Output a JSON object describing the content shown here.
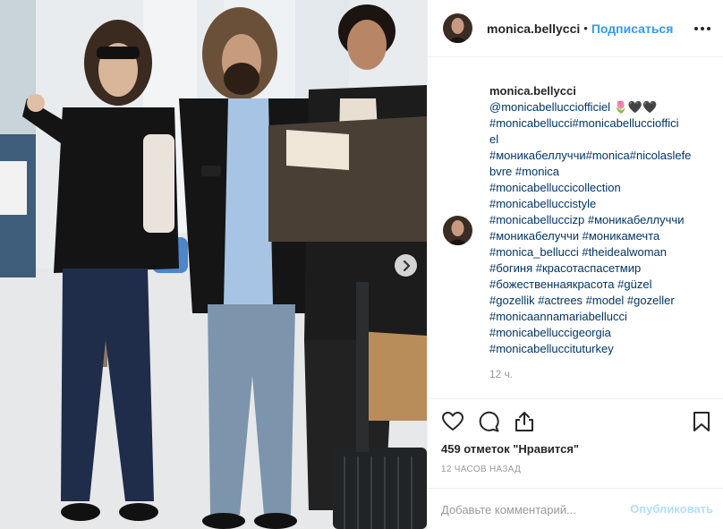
{
  "post": {
    "username": "monica.bellycci",
    "separator": "•",
    "follow_label": "Подписаться",
    "caption": {
      "username": "monica.bellycci",
      "lines": [
        "@monicabellucciofficiel 🌷🖤🖤",
        "#monicabellucci#monicabelluccioffici",
        "el",
        "#моникабеллуччи#monica#nicolaslefe",
        "bvre #monica",
        "#monicabelluccicollection",
        "#monicabelluccistyle",
        "#monicabelluccizp #моникабеллуччи",
        "#моникабелуччи #моникамечта",
        "#monica_bellucci #theidealwoman",
        "#богиня #красотаспасетмир",
        "#божественнаякрасота #güzel",
        "#gozellik #actrees #model #gozeller",
        "#monicaannamariabellucci",
        "#monicabelluccigeorgia",
        "#monicabelluccituturkey"
      ],
      "time": "12 ч."
    },
    "likes": "459 отметок \"Нравится\"",
    "posted_ago": "12 часов назад",
    "comment": {
      "placeholder": "Добавьте комментарий...",
      "publish_label": "Опубликовать"
    },
    "icons": {
      "more": "more-horizontal-icon",
      "like": "heart-icon",
      "comment": "comment-bubble-icon",
      "share": "share-icon",
      "save": "bookmark-icon",
      "next": "chevron-right-icon"
    },
    "colors": {
      "link": "#003569",
      "accent": "#3897f0",
      "muted": "#999999",
      "publish_disabled": "#b2dffc"
    }
  }
}
